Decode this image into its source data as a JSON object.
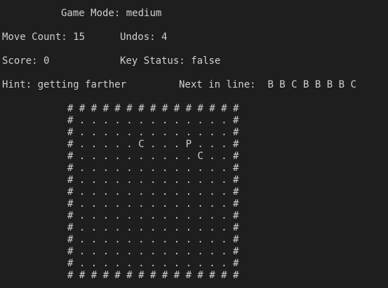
{
  "header": {
    "mode_label": "Game Mode:",
    "mode_value": "medium"
  },
  "stats": {
    "move_count_label": "Move Count:",
    "move_count_value": "15",
    "undos_label": "Undos:",
    "undos_value": "4",
    "score_label": "Score:",
    "score_value": "0",
    "key_status_label": "Key Status:",
    "key_status_value": "false"
  },
  "hint": {
    "label": "Hint:",
    "value": "getting farther",
    "next_label": "Next in line:",
    "next_queue": "B B C B B B B C"
  },
  "board": {
    "rows": [
      "# # # # # # # # # # # # # # #",
      "# . . . . . . . . . . . . . #",
      "# . . . . . . . . . . . . . #",
      "# . . . . . C . . . P . . . #",
      "# . . . . . . . . . . C . . #",
      "# . . . . . . . . . . . . . #",
      "# . . . . . . . . . . . . . #",
      "# . . . . . . . . . . . . . #",
      "# . . . . . . . . . . . . . #",
      "# . . . . . . . . . . . . . #",
      "# . . . . . . . . . . . . . #",
      "# . . . . . . . . . . . . . #",
      "# . . . . . . . . . . . . . #",
      "# . . . . . . . . . . . . . #",
      "# # # # # # # # # # # # # # #"
    ]
  }
}
